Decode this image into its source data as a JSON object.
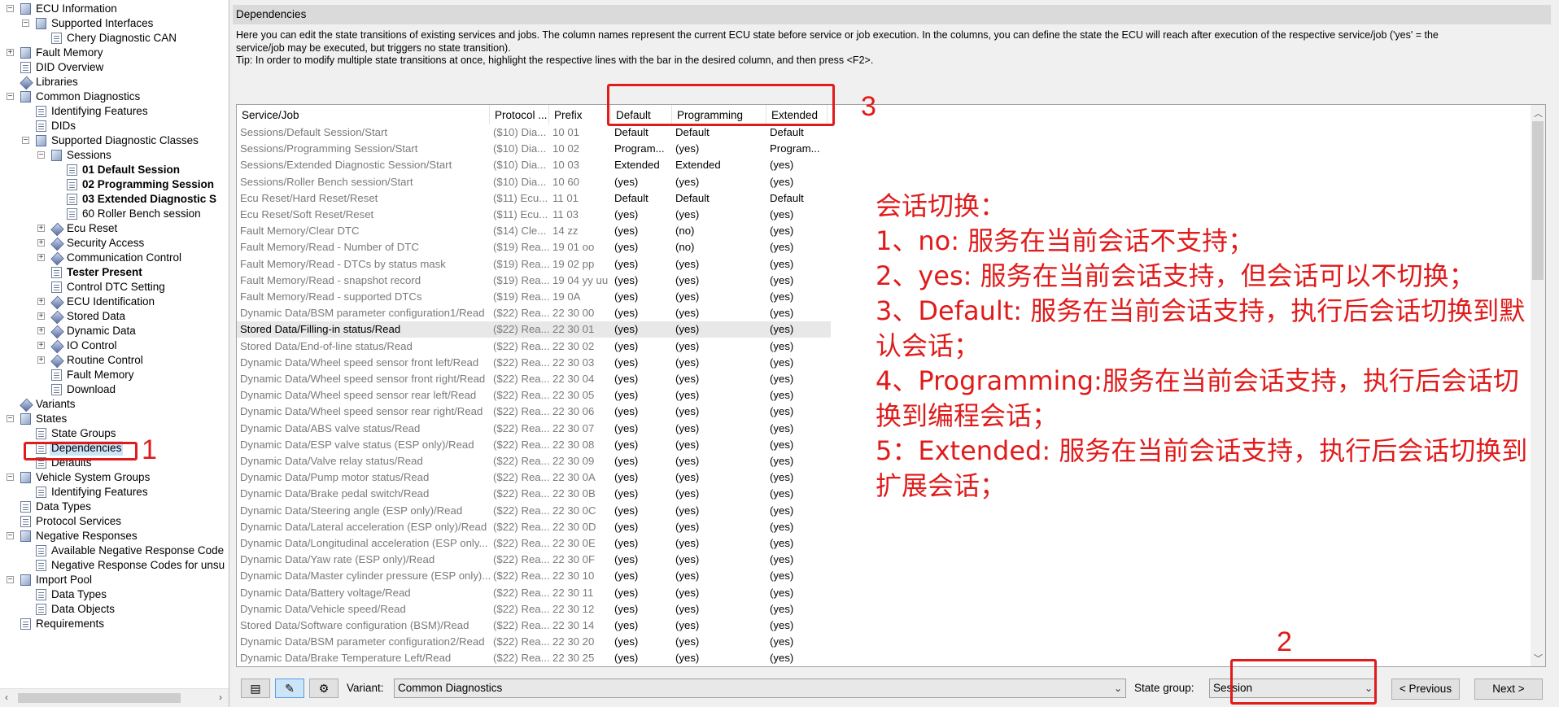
{
  "tree": [
    {
      "label": "ECU Information",
      "indent": 0,
      "exp": "−",
      "icon": "folder"
    },
    {
      "label": "Supported Interfaces",
      "indent": 1,
      "exp": "−",
      "icon": "folder"
    },
    {
      "label": "Chery Diagnostic CAN",
      "indent": 2,
      "exp": "",
      "icon": "doc"
    },
    {
      "label": "Fault Memory",
      "indent": 0,
      "exp": "+",
      "icon": "folder"
    },
    {
      "label": "DID Overview",
      "indent": 0,
      "exp": "",
      "icon": "doc"
    },
    {
      "label": "Libraries",
      "indent": 0,
      "exp": "",
      "icon": "gem"
    },
    {
      "label": "Common Diagnostics",
      "indent": 0,
      "exp": "−",
      "icon": "folder"
    },
    {
      "label": "Identifying Features",
      "indent": 1,
      "exp": "",
      "icon": "doc"
    },
    {
      "label": "DIDs",
      "indent": 1,
      "exp": "",
      "icon": "doc"
    },
    {
      "label": "Supported Diagnostic Classes",
      "indent": 1,
      "exp": "−",
      "icon": "folder"
    },
    {
      "label": "Sessions",
      "indent": 2,
      "exp": "−",
      "icon": "folder"
    },
    {
      "label": "01 Default Session",
      "indent": 3,
      "exp": "",
      "icon": "doc",
      "bold": true
    },
    {
      "label": "02 Programming Session",
      "indent": 3,
      "exp": "",
      "icon": "doc",
      "bold": true
    },
    {
      "label": "03 Extended Diagnostic S",
      "indent": 3,
      "exp": "",
      "icon": "doc",
      "bold": true
    },
    {
      "label": "60 Roller Bench session",
      "indent": 3,
      "exp": "",
      "icon": "doc"
    },
    {
      "label": "Ecu Reset",
      "indent": 2,
      "exp": "+",
      "icon": "gem"
    },
    {
      "label": "Security Access",
      "indent": 2,
      "exp": "+",
      "icon": "gem"
    },
    {
      "label": "Communication Control",
      "indent": 2,
      "exp": "+",
      "icon": "gem"
    },
    {
      "label": "Tester Present",
      "indent": 2,
      "exp": "",
      "icon": "doc",
      "bold": true
    },
    {
      "label": "Control DTC Setting",
      "indent": 2,
      "exp": "",
      "icon": "doc"
    },
    {
      "label": "ECU Identification",
      "indent": 2,
      "exp": "+",
      "icon": "gem"
    },
    {
      "label": "Stored Data",
      "indent": 2,
      "exp": "+",
      "icon": "gem"
    },
    {
      "label": "Dynamic Data",
      "indent": 2,
      "exp": "+",
      "icon": "gem"
    },
    {
      "label": "IO Control",
      "indent": 2,
      "exp": "+",
      "icon": "gem"
    },
    {
      "label": "Routine Control",
      "indent": 2,
      "exp": "+",
      "icon": "gem"
    },
    {
      "label": "Fault Memory",
      "indent": 2,
      "exp": "",
      "icon": "doc"
    },
    {
      "label": "Download",
      "indent": 2,
      "exp": "",
      "icon": "doc"
    },
    {
      "label": "Variants",
      "indent": 0,
      "exp": "",
      "icon": "gem"
    },
    {
      "label": "States",
      "indent": 0,
      "exp": "−",
      "icon": "folder"
    },
    {
      "label": "State Groups",
      "indent": 1,
      "exp": "",
      "icon": "doc"
    },
    {
      "label": "Dependencies",
      "indent": 1,
      "exp": "",
      "icon": "doc",
      "selected": true
    },
    {
      "label": "Defaults",
      "indent": 1,
      "exp": "",
      "icon": "doc"
    },
    {
      "label": "Vehicle System Groups",
      "indent": 0,
      "exp": "−",
      "icon": "folder"
    },
    {
      "label": "Identifying Features",
      "indent": 1,
      "exp": "",
      "icon": "doc"
    },
    {
      "label": "Data Types",
      "indent": 0,
      "exp": "",
      "icon": "doc"
    },
    {
      "label": "Protocol Services",
      "indent": 0,
      "exp": "",
      "icon": "doc"
    },
    {
      "label": "Negative Responses",
      "indent": 0,
      "exp": "−",
      "icon": "folder"
    },
    {
      "label": "Available Negative Response Code",
      "indent": 1,
      "exp": "",
      "icon": "doc"
    },
    {
      "label": "Negative Response Codes for unsu",
      "indent": 1,
      "exp": "",
      "icon": "doc"
    },
    {
      "label": "Import Pool",
      "indent": 0,
      "exp": "−",
      "icon": "folder"
    },
    {
      "label": "Data Types",
      "indent": 1,
      "exp": "",
      "icon": "doc"
    },
    {
      "label": "Data Objects",
      "indent": 1,
      "exp": "",
      "icon": "doc"
    },
    {
      "label": "Requirements",
      "indent": 0,
      "exp": "",
      "icon": "doc"
    }
  ],
  "panel_title": "Dependencies",
  "description": [
    "Here you can edit the state transitions of existing services and jobs. The column names represent the current ECU state before service or job execution. In the columns, you can define the state the ECU will reach after execution of the respective service/job ('yes' = the",
    "service/job may be executed, but triggers no state transition).",
    "Tip: In order to modify multiple state transitions at once, highlight the respective lines with the bar in the desired column, and then press <F2>."
  ],
  "columns": [
    "Service/Job",
    "Protocol ...",
    "Prefix",
    "Default",
    "Programming",
    "Extended"
  ],
  "rows": [
    [
      "Sessions/Default Session/Start",
      "($10) Dia...",
      "10 01",
      "Default",
      "Default",
      "Default"
    ],
    [
      "Sessions/Programming Session/Start",
      "($10) Dia...",
      "10 02",
      "Program...",
      "(yes)",
      "Program..."
    ],
    [
      "Sessions/Extended Diagnostic Session/Start",
      "($10) Dia...",
      "10 03",
      "Extended",
      "Extended",
      "(yes)"
    ],
    [
      "Sessions/Roller Bench session/Start",
      "($10) Dia...",
      "10 60",
      "(yes)",
      "(yes)",
      "(yes)"
    ],
    [
      "Ecu Reset/Hard Reset/Reset",
      "($11) Ecu...",
      "11 01",
      "Default",
      "Default",
      "Default"
    ],
    [
      "Ecu Reset/Soft Reset/Reset",
      "($11) Ecu...",
      "11 03",
      "(yes)",
      "(yes)",
      "(yes)"
    ],
    [
      "Fault Memory/Clear DTC",
      "($14) Cle...",
      "14 zz",
      "(yes)",
      "(no)",
      "(yes)"
    ],
    [
      "Fault Memory/Read - Number of DTC",
      "($19) Rea...",
      "19 01 oo",
      "(yes)",
      "(no)",
      "(yes)"
    ],
    [
      "Fault Memory/Read - DTCs by status mask",
      "($19) Rea...",
      "19 02 pp",
      "(yes)",
      "(yes)",
      "(yes)"
    ],
    [
      "Fault Memory/Read - snapshot record",
      "($19) Rea...",
      "19 04 yy uu",
      "(yes)",
      "(yes)",
      "(yes)"
    ],
    [
      "Fault Memory/Read - supported DTCs",
      "($19) Rea...",
      "19 0A",
      "(yes)",
      "(yes)",
      "(yes)"
    ],
    [
      "Dynamic Data/BSM parameter configuration1/Read",
      "($22) Rea...",
      "22 30 00",
      "(yes)",
      "(yes)",
      "(yes)"
    ],
    [
      "Stored Data/Filling-in status/Read",
      "($22) Rea...",
      "22 30 01",
      "(yes)",
      "(yes)",
      "(yes)"
    ],
    [
      "Stored Data/End-of-line status/Read",
      "($22) Rea...",
      "22 30 02",
      "(yes)",
      "(yes)",
      "(yes)"
    ],
    [
      "Dynamic Data/Wheel speed sensor front left/Read",
      "($22) Rea...",
      "22 30 03",
      "(yes)",
      "(yes)",
      "(yes)"
    ],
    [
      "Dynamic Data/Wheel speed sensor front right/Read",
      "($22) Rea...",
      "22 30 04",
      "(yes)",
      "(yes)",
      "(yes)"
    ],
    [
      "Dynamic Data/Wheel speed sensor rear left/Read",
      "($22) Rea...",
      "22 30 05",
      "(yes)",
      "(yes)",
      "(yes)"
    ],
    [
      "Dynamic Data/Wheel speed sensor rear right/Read",
      "($22) Rea...",
      "22 30 06",
      "(yes)",
      "(yes)",
      "(yes)"
    ],
    [
      "Dynamic Data/ABS valve status/Read",
      "($22) Rea...",
      "22 30 07",
      "(yes)",
      "(yes)",
      "(yes)"
    ],
    [
      "Dynamic Data/ESP valve status (ESP only)/Read",
      "($22) Rea...",
      "22 30 08",
      "(yes)",
      "(yes)",
      "(yes)"
    ],
    [
      "Dynamic Data/Valve relay status/Read",
      "($22) Rea...",
      "22 30 09",
      "(yes)",
      "(yes)",
      "(yes)"
    ],
    [
      "Dynamic Data/Pump motor status/Read",
      "($22) Rea...",
      "22 30 0A",
      "(yes)",
      "(yes)",
      "(yes)"
    ],
    [
      "Dynamic Data/Brake pedal switch/Read",
      "($22) Rea...",
      "22 30 0B",
      "(yes)",
      "(yes)",
      "(yes)"
    ],
    [
      "Dynamic Data/Steering angle (ESP only)/Read",
      "($22) Rea...",
      "22 30 0C",
      "(yes)",
      "(yes)",
      "(yes)"
    ],
    [
      "Dynamic Data/Lateral acceleration (ESP only)/Read",
      "($22) Rea...",
      "22 30 0D",
      "(yes)",
      "(yes)",
      "(yes)"
    ],
    [
      "Dynamic Data/Longitudinal acceleration (ESP only...",
      "($22) Rea...",
      "22 30 0E",
      "(yes)",
      "(yes)",
      "(yes)"
    ],
    [
      "Dynamic Data/Yaw rate (ESP only)/Read",
      "($22) Rea...",
      "22 30 0F",
      "(yes)",
      "(yes)",
      "(yes)"
    ],
    [
      "Dynamic Data/Master cylinder pressure (ESP only)...",
      "($22) Rea...",
      "22 30 10",
      "(yes)",
      "(yes)",
      "(yes)"
    ],
    [
      "Dynamic Data/Battery voltage/Read",
      "($22) Rea...",
      "22 30 11",
      "(yes)",
      "(yes)",
      "(yes)"
    ],
    [
      "Dynamic Data/Vehicle speed/Read",
      "($22) Rea...",
      "22 30 12",
      "(yes)",
      "(yes)",
      "(yes)"
    ],
    [
      "Stored Data/Software configuration (BSM)/Read",
      "($22) Rea...",
      "22 30 14",
      "(yes)",
      "(yes)",
      "(yes)"
    ],
    [
      "Dynamic Data/BSM parameter configuration2/Read",
      "($22) Rea...",
      "22 30 20",
      "(yes)",
      "(yes)",
      "(yes)"
    ],
    [
      "Dynamic Data/Brake Temperature Left/Read",
      "($22) Rea...",
      "22 30 25",
      "(yes)",
      "(yes)",
      "(yes)"
    ]
  ],
  "highlighted_row": 12,
  "annotations": {
    "n1": "1",
    "n2": "2",
    "n3": "3",
    "note": [
      "会话切换：",
      "1、no: 服务在当前会话不支持；",
      "2、yes: 服务在当前会话支持，但会话可以不切换；",
      "3、Default: 服务在当前会话支持，执行后会话切换到默",
      "认会话；",
      "4、Programming:服务在当前会话支持，执行后会话切",
      "换到编程会话；",
      "5：Extended: 服务在当前会话支持，执行后会话切换到",
      "扩展会话；"
    ],
    "color": "#e01b1b"
  },
  "bottom": {
    "variant_label": "Variant:",
    "variant_value": "Common Diagnostics",
    "state_group_label": "State group:",
    "state_group_value": "Session",
    "prev_label": "< Previous",
    "next_label": "Next >"
  }
}
